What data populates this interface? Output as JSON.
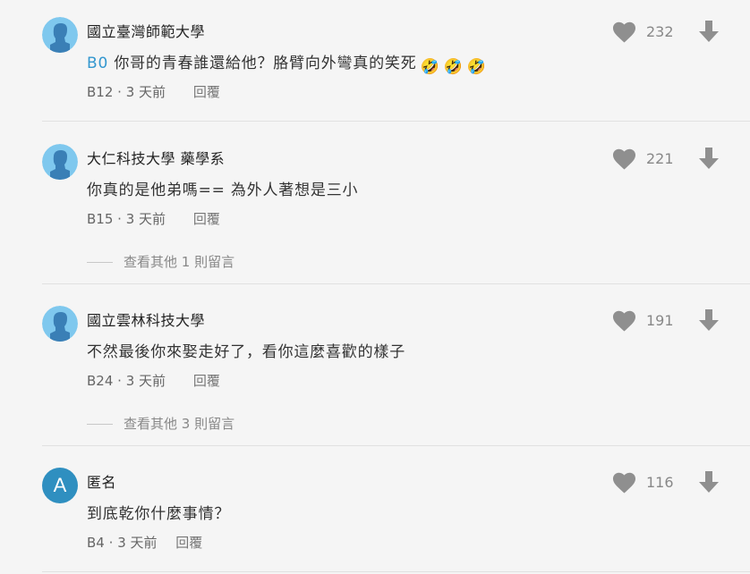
{
  "comments": [
    {
      "author": "國立臺灣師範大學",
      "avatar_type": "default-person-avatar",
      "mention": "B0",
      "text": "你哥的青春誰還給他？胳臂向外彎真的笑死",
      "emojis": [
        "🤣",
        "🤣",
        "🤣"
      ],
      "floor": "B12",
      "time": "3 天前",
      "reply_label": "回覆",
      "likes": "232"
    },
    {
      "author": "大仁科技大學 藥學系",
      "avatar_type": "default-person-avatar",
      "text": "你真的是他弟嗎== 為外人著想是三小",
      "floor": "B15",
      "time": "3 天前",
      "reply_label": "回覆",
      "more_replies": "查看其他 1 則留言",
      "likes": "221"
    },
    {
      "author": "國立雲林科技大學",
      "avatar_type": "default-person-avatar",
      "text": "不然最後你來娶走好了，看你這麼喜歡的樣子",
      "floor": "B24",
      "time": "3 天前",
      "reply_label": "回覆",
      "more_replies": "查看其他 3 則留言",
      "likes": "191"
    },
    {
      "author": "匿名",
      "avatar_letter": "A",
      "text": "到底乾你什麼事情？",
      "floor": "B4",
      "time": "3 天前",
      "reply_label": "回覆",
      "likes": "116"
    }
  ],
  "colors": {
    "background": "#f5f5f5",
    "mention": "#3397cf",
    "avatar_bg": "#7fc8ee",
    "avatar_letter_bg": "#2f8fc0",
    "icon_gray": "#8f8f8f"
  },
  "icons": {
    "like": "heart-icon",
    "downvote": "arrow-down-icon"
  }
}
